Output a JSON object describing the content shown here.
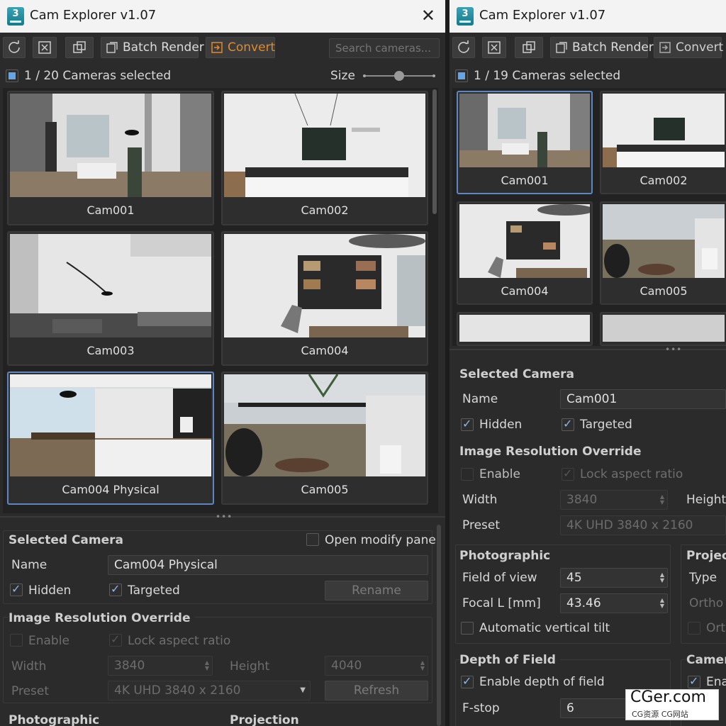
{
  "left": {
    "title": "Cam Explorer v1.07",
    "app_icon_text": "3",
    "toolbar": {
      "batch_render": "Batch Render",
      "convert": "Convert",
      "search_placeholder": "Search cameras..."
    },
    "selection_text": "1 / 20 Cameras selected",
    "size_label": "Size",
    "thumbnails": [
      "Cam001",
      "Cam002",
      "Cam003",
      "Cam004",
      "Cam004 Physical",
      "Cam005"
    ],
    "selected_camera": {
      "heading": "Selected Camera",
      "open_modify_panel": "Open modify panel",
      "name_label": "Name",
      "name_value": "Cam004 Physical",
      "hidden_label": "Hidden",
      "targeted_label": "Targeted",
      "rename_button": "Rename"
    },
    "resolution": {
      "heading": "Image Resolution Override",
      "enable_label": "Enable",
      "lock_label": "Lock aspect ratio",
      "width_label": "Width",
      "width_value": "3840",
      "height_label": "Height",
      "height_value": "4040",
      "preset_label": "Preset",
      "preset_value": "4K UHD 3840 x 2160",
      "refresh_button": "Refresh"
    },
    "photographic_heading": "Photographic",
    "projection_heading": "Projection"
  },
  "right": {
    "title": "Cam Explorer v1.07",
    "app_icon_text": "3",
    "toolbar": {
      "batch_render": "Batch Render",
      "convert": "Convert"
    },
    "selection_text": "1 / 19 Cameras selected",
    "thumbnails": [
      "Cam001",
      "Cam002",
      "Cam004",
      "Cam005"
    ],
    "selected_camera": {
      "heading": "Selected Camera",
      "name_label": "Name",
      "name_value": "Cam001",
      "hidden_label": "Hidden",
      "targeted_label": "Targeted"
    },
    "resolution": {
      "heading": "Image Resolution Override",
      "enable_label": "Enable",
      "lock_label": "Lock aspect ratio",
      "width_label": "Width",
      "width_value": "3840",
      "height_label": "Height",
      "preset_label": "Preset",
      "preset_value": "4K UHD 3840 x 2160"
    },
    "photographic": {
      "heading": "Photographic",
      "fov_label": "Field of view",
      "fov_value": "45",
      "focal_label": "Focal L [mm]",
      "focal_value": "43.46",
      "auto_tilt_label": "Automatic vertical tilt"
    },
    "projection": {
      "heading": "Projec",
      "type_label": "Type",
      "ortho_label": "Ortho v",
      "orth_label": "Orth"
    },
    "dof": {
      "heading": "Depth of Field",
      "enable_label": "Enable depth of field",
      "fstop_label": "F-stop",
      "fstop_value": "6"
    },
    "camera": {
      "heading": "Camer",
      "enable_label": "Ena"
    }
  },
  "watermark": {
    "main": "CGer.com",
    "sub": "CG资源 CG网站"
  },
  "colors": {
    "panel": "#2b2b2b",
    "titlebar": "#f3f3f3",
    "selection_border": "#5d86c2",
    "accent_orange": "#e08a2c"
  }
}
